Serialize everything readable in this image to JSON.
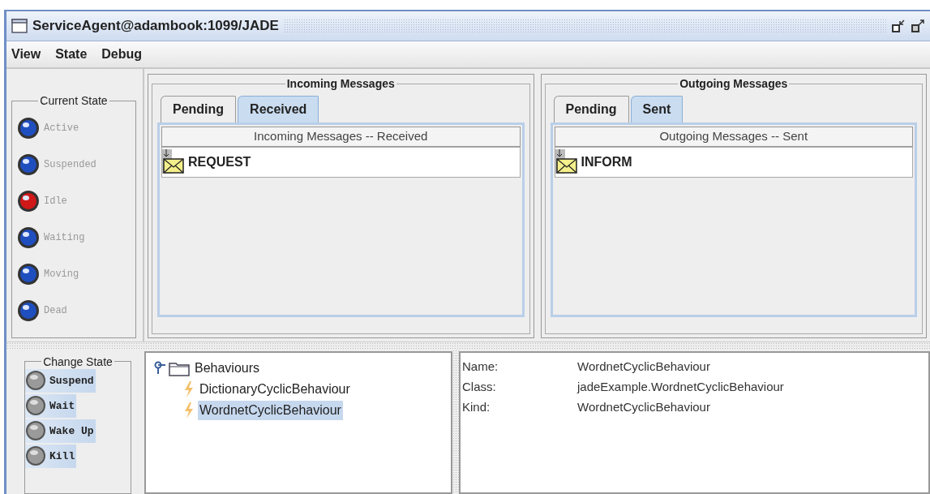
{
  "window": {
    "title": "ServiceAgent@adambook:1099/JADE"
  },
  "menu": [
    "View",
    "State",
    "Debug"
  ],
  "current_state": {
    "title": "Current State",
    "states": [
      {
        "label": "Active",
        "color": "#1f4fbf"
      },
      {
        "label": "Suspended",
        "color": "#1f4fbf"
      },
      {
        "label": "Idle",
        "color": "#d01818"
      },
      {
        "label": "Waiting",
        "color": "#1f4fbf"
      },
      {
        "label": "Moving",
        "color": "#1f4fbf"
      },
      {
        "label": "Dead",
        "color": "#1f4fbf"
      }
    ]
  },
  "change_state": {
    "title": "Change State",
    "buttons": [
      "Suspend",
      "Wait",
      "Wake Up",
      "Kill"
    ]
  },
  "message_panels": [
    {
      "title": "Incoming Messages",
      "tabs": [
        {
          "label": "Pending",
          "selected": false
        },
        {
          "label": "Received",
          "selected": true
        }
      ],
      "table_header": "Incoming Messages --  Received",
      "messages": [
        "REQUEST"
      ]
    },
    {
      "title": "Outgoing Messages",
      "tabs": [
        {
          "label": "Pending",
          "selected": false
        },
        {
          "label": "Sent",
          "selected": true
        }
      ],
      "table_header": "Outgoing Messages -- Sent",
      "messages": [
        "INFORM"
      ]
    }
  ],
  "behaviours": [
    {
      "label": "Behaviours",
      "expanded": true,
      "children": [
        {
          "label": "DictionaryCyclicBehaviour",
          "selected": false
        },
        {
          "label": "WordnetCyclicBehaviour",
          "selected": true
        }
      ]
    }
  ],
  "details": [
    {
      "label": "Name:",
      "value": "WordnetCyclicBehaviour"
    },
    {
      "label": "Class:",
      "value": "jadeExample.WordnetCyclicBehaviour"
    },
    {
      "label": "Kind:",
      "value": "WordnetCyclicBehaviour"
    }
  ]
}
